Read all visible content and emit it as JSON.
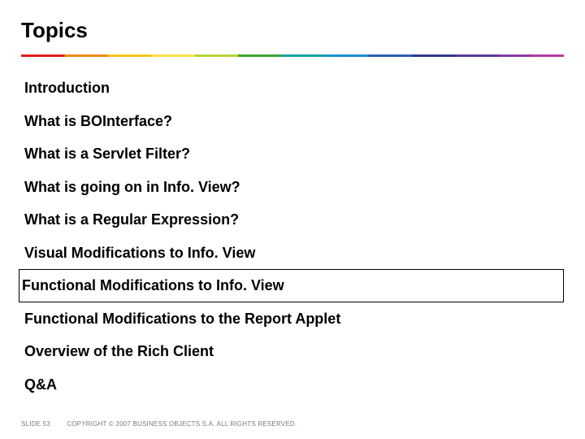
{
  "title": "Topics",
  "topics": [
    {
      "label": "Introduction",
      "current": false
    },
    {
      "label": "What is BOInterface?",
      "current": false
    },
    {
      "label": "What is a Servlet Filter?",
      "current": false
    },
    {
      "label": "What is going on in Info. View?",
      "current": false
    },
    {
      "label": "What is a Regular Expression?",
      "current": false
    },
    {
      "label": "Visual Modifications to Info. View",
      "current": false
    },
    {
      "label": "Functional Modifications to Info. View",
      "current": true
    },
    {
      "label": "Functional Modifications to the Report Applet",
      "current": false
    },
    {
      "label": "Overview of the Rich Client",
      "current": false
    },
    {
      "label": "Q&A",
      "current": false
    }
  ],
  "footer": {
    "slide_label": "SLIDE 53",
    "copyright": "COPYRIGHT © 2007 BUSINESS OBJECTS S.A. ALL RIGHTS RESERVED."
  }
}
